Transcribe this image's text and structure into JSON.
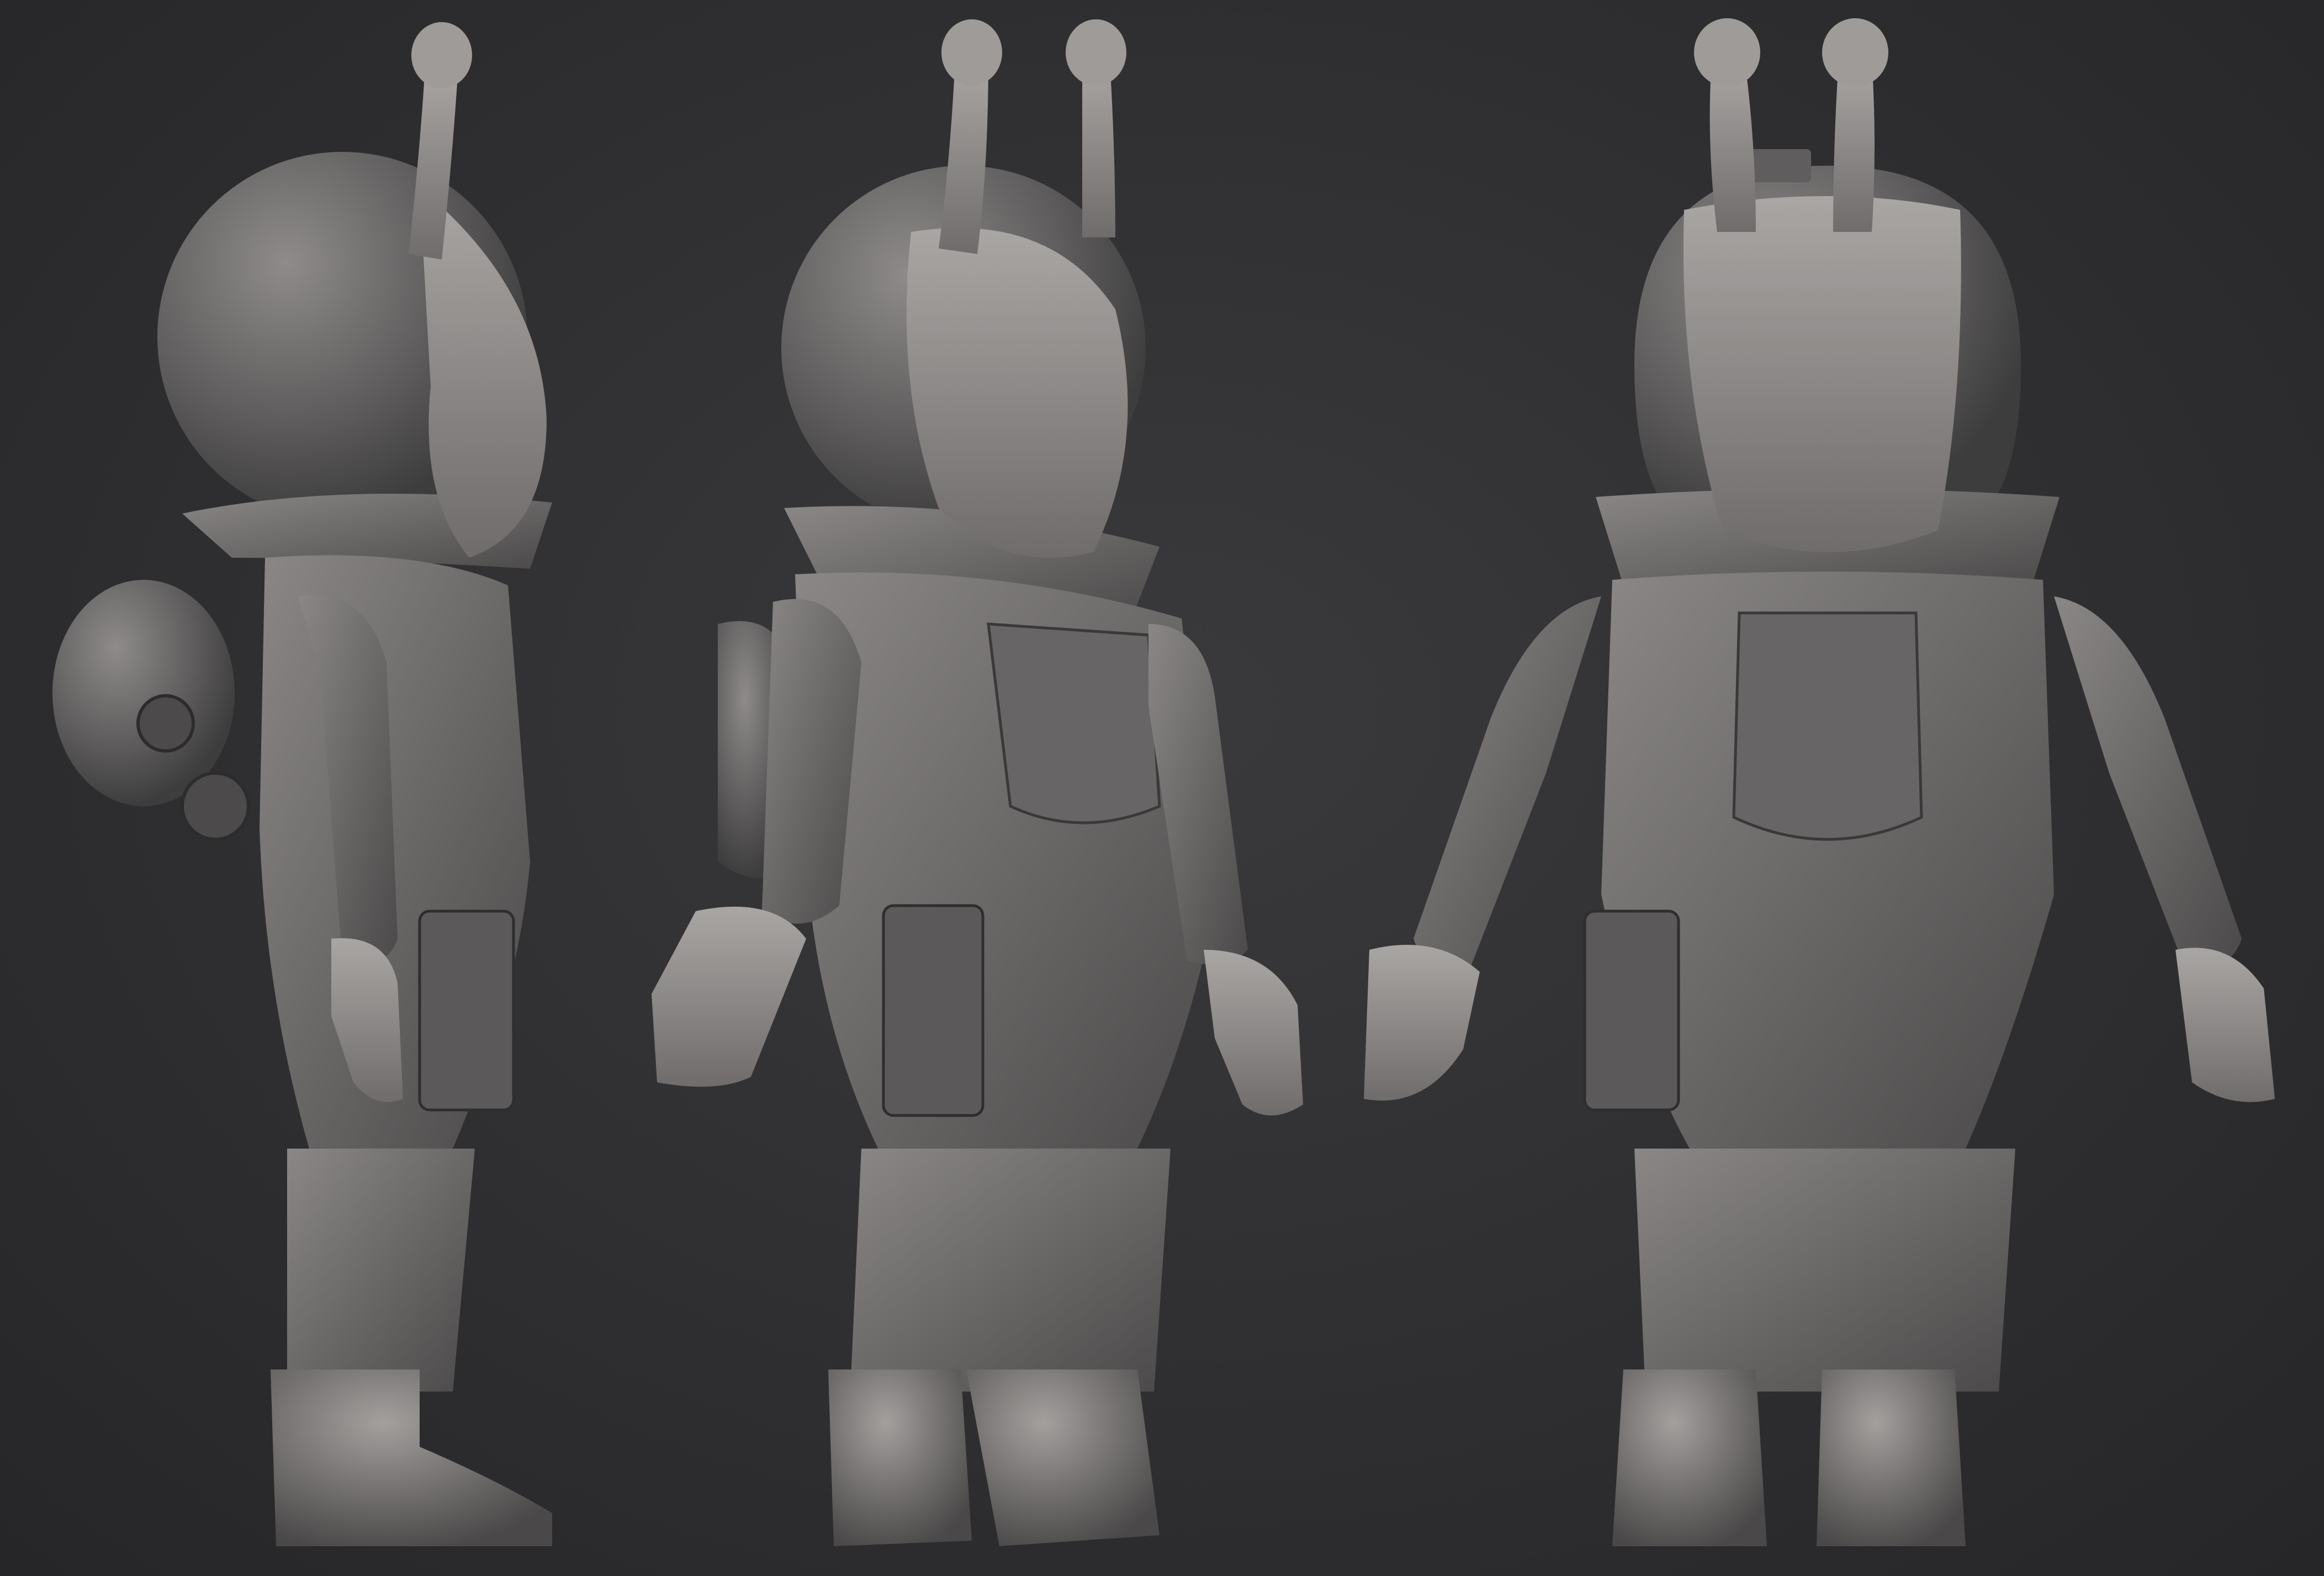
{
  "scene": {
    "description_kind": "turnaround-render",
    "views": [
      {
        "name": "side-view"
      },
      {
        "name": "three-quarter-view"
      },
      {
        "name": "front-view"
      }
    ],
    "colors": {
      "background": "#2f2f31",
      "clay": "#6f6d6c",
      "clay_light": "#9a9795",
      "clay_dark": "#3f3e3e",
      "seam": "#4a2a2a"
    }
  }
}
